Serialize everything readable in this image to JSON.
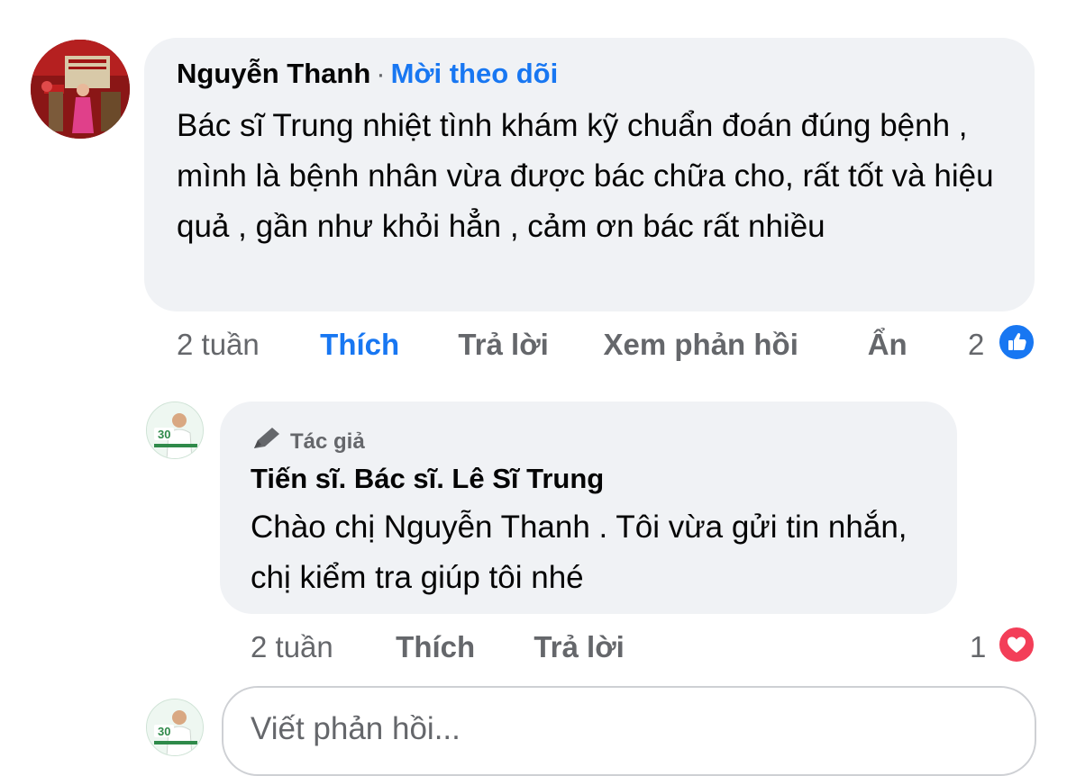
{
  "comment": {
    "author": "Nguyễn Thanh",
    "separator": "·",
    "follow_label": "Mời theo dõi",
    "text": "Bác sĩ Trung nhiệt tình khám kỹ chuẩn đoán đúng bệnh , mình là bệnh nhân vừa được bác chữa cho, rất tốt và hiệu quả , gần như khỏi hẳn , cảm ơn bác rất nhiều",
    "time": "2 tuần",
    "like_label": "Thích",
    "reply_label": "Trả lời",
    "see_replies_label": "Xem phản hồi",
    "hide_label": "Ẩn",
    "reaction_count": "2",
    "reaction_icon": "like-icon",
    "reaction_color": "#1877f2"
  },
  "reply": {
    "badge": "Tác giả",
    "badge_icon": "pen-icon",
    "author": "Tiến sĩ. Bác sĩ. Lê Sĩ Trung",
    "text": "Chào chị Nguyễn Thanh . Tôi vừa gửi tin nhắn, chị kiểm tra giúp tôi nhé",
    "time": "2 tuần",
    "like_label": "Thích",
    "reply_label": "Trả lời",
    "reaction_count": "1",
    "reaction_icon": "heart-icon",
    "reaction_color": "#f33e58"
  },
  "composer": {
    "placeholder": "Viết phản hồi..."
  },
  "avatar_badge": "30"
}
